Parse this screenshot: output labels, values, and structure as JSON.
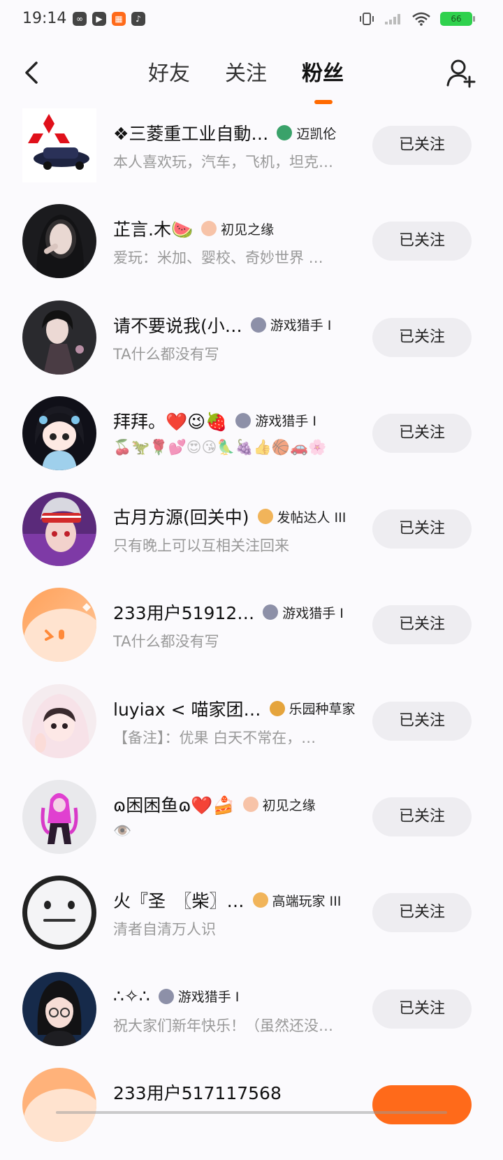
{
  "status_bar": {
    "time": "19:14",
    "battery": "66",
    "app_icons": [
      "link-app-icon",
      "play-app-icon",
      "grid-app-icon",
      "music-app-icon"
    ]
  },
  "header": {
    "tabs": [
      {
        "label": "好友",
        "active": false
      },
      {
        "label": "关注",
        "active": false
      },
      {
        "label": "粉丝",
        "active": true
      }
    ],
    "accent_color": "#ff6a00"
  },
  "followers": [
    {
      "name": "❖三菱重工业自動…",
      "badge": "迈凯伦",
      "bio": "本人喜欢玩，汽车，飞机，坦克…",
      "button": "已关注",
      "avatar": "car-logo"
    },
    {
      "name": "芷言.木🍉",
      "badge": "初见之缘",
      "bio": "爱玩：米加、婴校、奇妙世界 …",
      "button": "已关注",
      "avatar": "girl-photo"
    },
    {
      "name": "请不要说我(小…",
      "badge": "游戏猎手 I",
      "bio": "TA什么都没有写",
      "button": "已关注",
      "avatar": "girl-photo-2"
    },
    {
      "name": "拜拜。❤️😉🍓",
      "badge": "游戏猎手 I",
      "bio": "🍒🦖🌹💕😍😘🦜🍇👍🏀🚗🌸",
      "button": "已关注",
      "avatar": "anime-girl"
    },
    {
      "name": "古月方源(回关中)",
      "badge": "发帖达人 III",
      "bio": "只有晚上可以互相关注回来",
      "button": "已关注",
      "avatar": "anime-boy"
    },
    {
      "name": "233用户51912…",
      "badge": "游戏猎手 I",
      "bio": "TA什么都没有写",
      "button": "已关注",
      "avatar": "default-orange"
    },
    {
      "name": "luyiax < 喵家团…",
      "badge": "乐园种草家",
      "bio": "【备注】：优果 白天不常在，…",
      "button": "已关注",
      "avatar": "girl-hood"
    },
    {
      "name": "ɷ困困鱼ɷ❤️🍰",
      "badge": "初见之缘",
      "bio": "👁️",
      "button": "已关注",
      "avatar": "pink-character"
    },
    {
      "name": "火『圣　〖柴〗…",
      "badge": "高端玩家 III",
      "bio": "清者自清万人识",
      "button": "已关注",
      "avatar": "neutral-face"
    },
    {
      "name": "∴✧∴",
      "badge": "游戏猎手 I",
      "bio": "祝大家们新年快乐！（虽然还没…",
      "button": "已关注",
      "avatar": "glasses-girl"
    },
    {
      "name": "233用户517117568",
      "badge": "",
      "bio": "",
      "button": "",
      "avatar": "default-orange"
    }
  ]
}
